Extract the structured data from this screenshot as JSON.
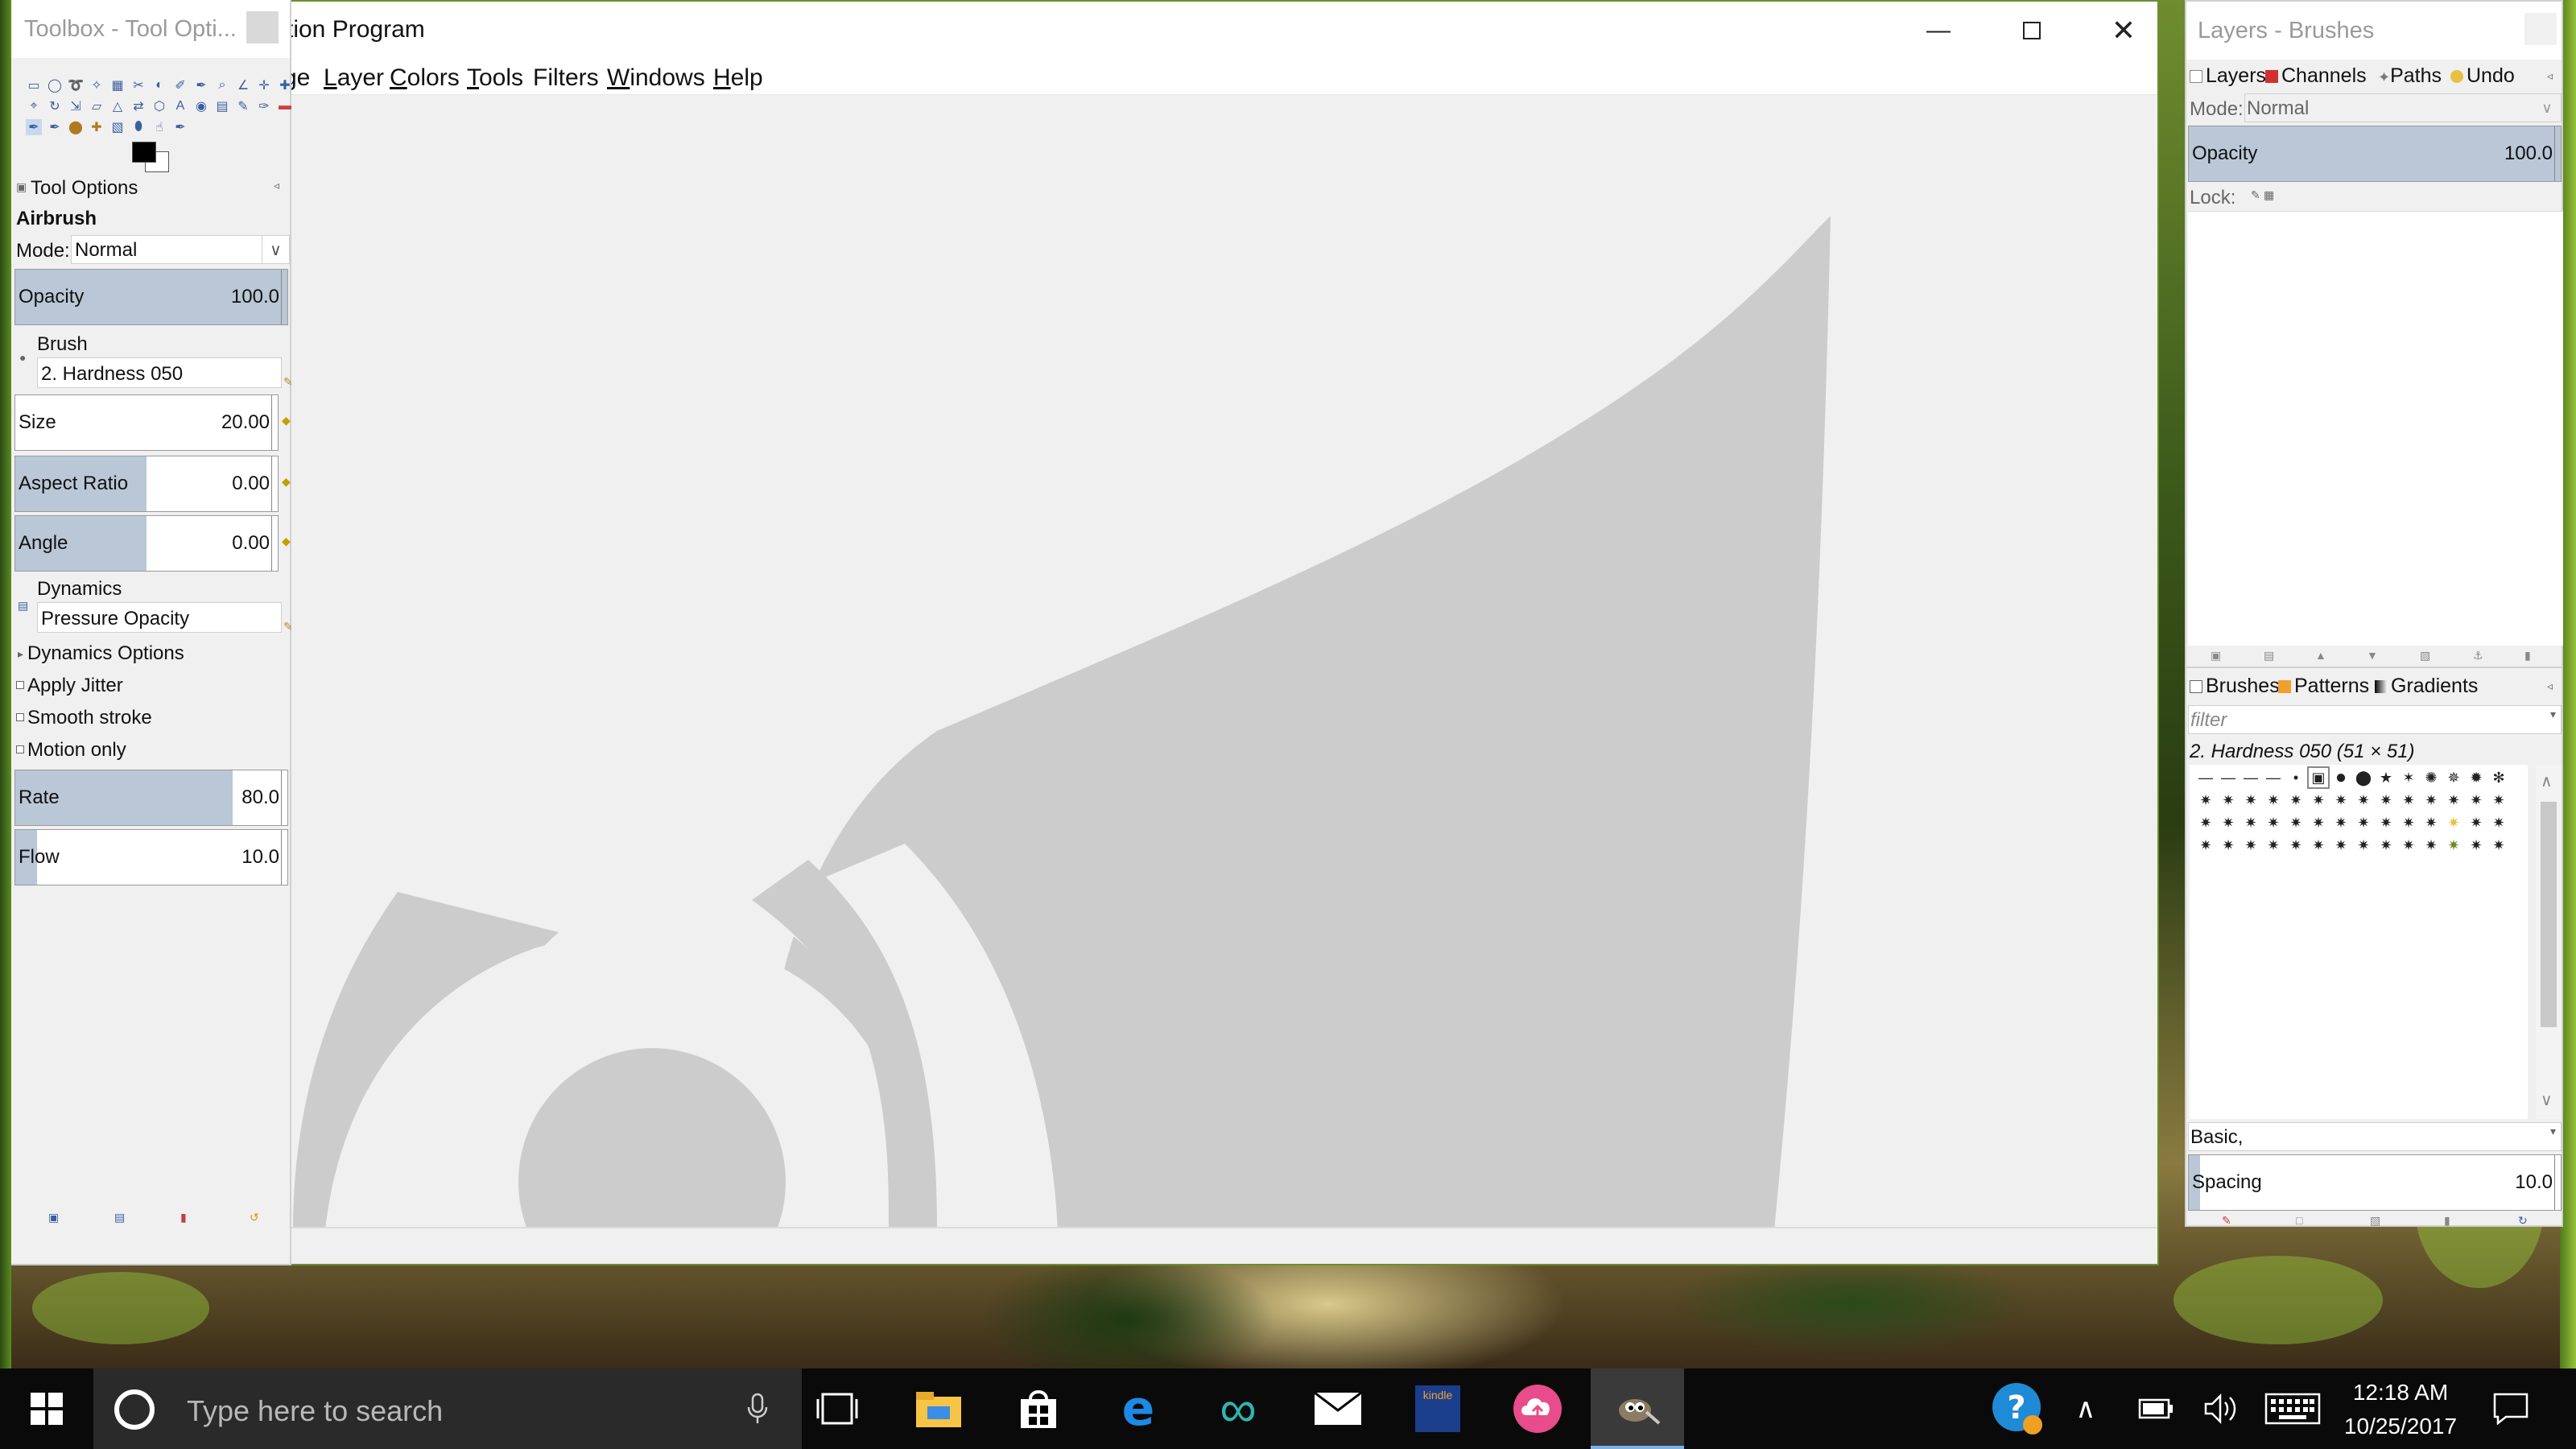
{
  "main_window": {
    "title": "tion Program",
    "menu": [
      "ge",
      "Layer",
      "Colors",
      "Tools",
      "Filters",
      "Windows",
      "Help"
    ],
    "menu_underlines": [
      "",
      "L",
      "C",
      "T",
      "",
      "W",
      "H"
    ]
  },
  "toolbox": {
    "title": "Toolbox - Tool Opti...",
    "tool_options_label": "Tool Options",
    "tool_name": "Airbrush",
    "mode_label": "Mode:",
    "mode_value": "Normal",
    "opacity_label": "Opacity",
    "opacity_value": "100.0",
    "brush_label": "Brush",
    "brush_value": "2. Hardness 050",
    "size_label": "Size",
    "size_value": "20.00",
    "aspect_label": "Aspect Ratio",
    "aspect_value": "0.00",
    "angle_label": "Angle",
    "angle_value": "0.00",
    "dynamics_label": "Dynamics",
    "dynamics_value": "Pressure Opacity",
    "dynamics_options_label": "Dynamics Options",
    "apply_jitter_label": "Apply Jitter",
    "smooth_stroke_label": "Smooth stroke",
    "motion_only_label": "Motion only",
    "rate_label": "Rate",
    "rate_value": "80.0",
    "flow_label": "Flow",
    "flow_value": "10.0",
    "opacity_level": 1.0,
    "size_level": 0.02,
    "aspect_level": 0.5,
    "angle_level": 0.5,
    "rate_level": 0.8,
    "flow_level": 0.1
  },
  "right_dock": {
    "title": "Layers - Brushes",
    "tabs_top": [
      "Layers",
      "Channels",
      "Paths",
      "Undo"
    ],
    "mode_label": "Mode:",
    "mode_value": "Normal",
    "opacity_label": "Opacity",
    "opacity_value": "100.0",
    "lock_label": "Lock:",
    "tabs_bottom": [
      "Brushes",
      "Patterns",
      "Gradients"
    ],
    "filter_placeholder": "filter",
    "selected_brush": "2. Hardness 050 (51 × 51)",
    "tag_value": "Basic,",
    "spacing_label": "Spacing",
    "spacing_value": "10.0",
    "spacing_level": 0.1
  },
  "taskbar": {
    "search_placeholder": "Type here to search",
    "time": "12:18 AM",
    "date": "10/25/2017",
    "kindle_label": "kindle"
  },
  "colors": {
    "accent": "#0078d7",
    "slider_fill": "#b9c7d6",
    "taskbar": "#0a0a0a",
    "canvas_logo": "#cccccc"
  }
}
